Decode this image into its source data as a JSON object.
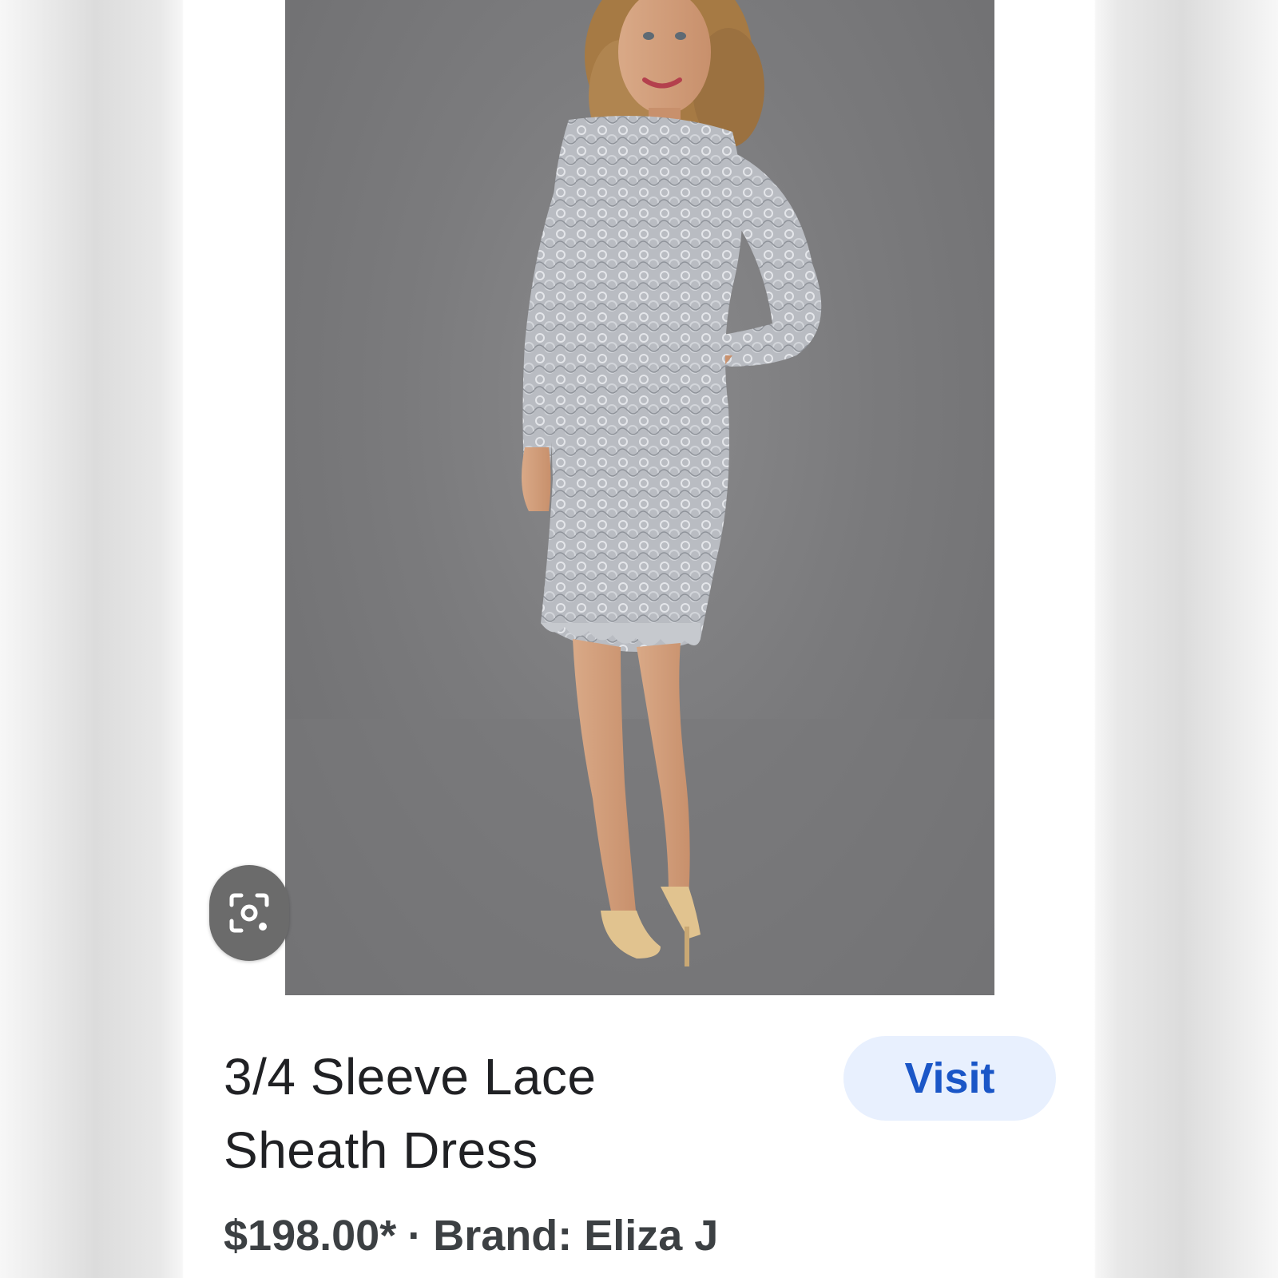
{
  "product": {
    "title_line1": "3/4 Sleeve Lace",
    "title_line2": "Sheath Dress",
    "price": "$198.00*",
    "separator": "·",
    "brand": "Brand: Eliza J"
  },
  "actions": {
    "visit_label": "Visit"
  },
  "icons": {
    "lens": "lens-search-icon"
  },
  "colors": {
    "visit_bg": "#e8f0fe",
    "visit_text": "#1a56c7",
    "lens_bg": "#6b6b6b",
    "dress": "#b9bcc2"
  }
}
